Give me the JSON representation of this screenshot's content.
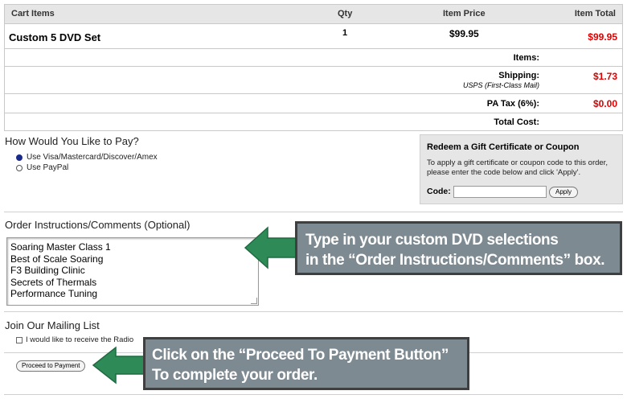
{
  "cart": {
    "headers": {
      "items": "Cart Items",
      "qty": "Qty",
      "price": "Item Price",
      "total": "Item Total"
    },
    "line": {
      "name": "Custom 5 DVD Set",
      "qty": "1",
      "price": "$99.95",
      "total": "$99.95"
    },
    "summary": {
      "items_label": "Items:",
      "shipping_label": "Shipping:",
      "shipping_method": "USPS (First-Class Mail)",
      "shipping_value": "$1.73",
      "tax_label": "PA Tax (6%):",
      "tax_value": "$0.00",
      "total_label": "Total Cost:"
    }
  },
  "payment": {
    "title": "How Would You Like to Pay?",
    "options": [
      "Use Visa/Mastercard/Discover/Amex",
      "Use PayPal"
    ],
    "selected_index": 0
  },
  "coupon": {
    "title": "Redeem a Gift Certificate or Coupon",
    "description": "To apply a gift certificate or coupon code to this order, please enter the code below and click 'Apply'.",
    "code_label": "Code:",
    "code_value": "",
    "apply_label": "Apply"
  },
  "comments": {
    "title": "Order Instructions/Comments (Optional)",
    "lines": [
      "Soaring Master Class 1",
      "Best of Scale Soaring",
      "F3 Building Clinic",
      "Secrets of Thermals",
      "Performance Tuning"
    ]
  },
  "mailing": {
    "title": "Join Our Mailing List",
    "checkbox_label": "I would like to receive the Radio",
    "checked": false
  },
  "proceed_label": "Proceed to Payment",
  "annotations": {
    "comments_tip": [
      [
        "Type in your custom DVD selections",
        ""
      ],
      [
        "in the ",
        "“Order Instructions/Comments”",
        " box."
      ]
    ],
    "proceed_tip": [
      "Click on the ",
      "“Proceed To Payment Button”",
      "To  complete  your order."
    ]
  },
  "colors": {
    "price_red": "#e00000",
    "arrow_green": "#2e8b57",
    "callout_gray": "#7e8a91"
  }
}
